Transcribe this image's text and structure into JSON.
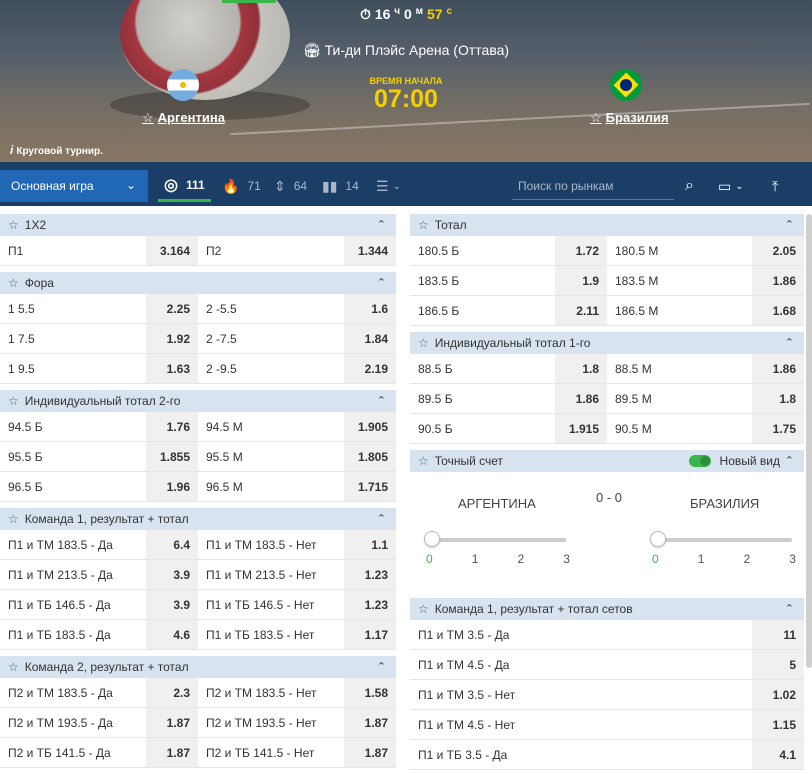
{
  "timer": {
    "hours": "16",
    "h_unit": "ч",
    "minutes": "0",
    "m_unit": "м",
    "seconds": "57",
    "s_unit": "с"
  },
  "venue": "Ти-ди Плэйс Арена (Оттава)",
  "start_label": "ВРЕМЯ НАЧАЛА",
  "start_time": "07:00",
  "team_a": "Аргентина",
  "team_b": "Бразилия",
  "tournament": "Круговой турнир.",
  "toolbar": {
    "dropdown": "Основная игра",
    "tab_all": "111",
    "tab_hot": "71",
    "tab_updown": "64",
    "tab_live": "14",
    "search_placeholder": "Поиск по рынкам"
  },
  "left": [
    {
      "title": "1X2",
      "rows": [
        [
          "П1",
          "3.164",
          "П2",
          "1.344"
        ]
      ]
    },
    {
      "title": "Фора",
      "rows": [
        [
          "1 5.5",
          "2.25",
          "2 -5.5",
          "1.6"
        ],
        [
          "1 7.5",
          "1.92",
          "2 -7.5",
          "1.84"
        ],
        [
          "1 9.5",
          "1.63",
          "2 -9.5",
          "2.19"
        ]
      ]
    },
    {
      "title": "Индивидуальный тотал 2-го",
      "rows": [
        [
          "94.5 Б",
          "1.76",
          "94.5 М",
          "1.905"
        ],
        [
          "95.5 Б",
          "1.855",
          "95.5 М",
          "1.805"
        ],
        [
          "96.5 Б",
          "1.96",
          "96.5 М",
          "1.715"
        ]
      ]
    },
    {
      "title": "Команда 1, результат + тотал",
      "rows": [
        [
          "П1 и ТМ 183.5 - Да",
          "6.4",
          "П1 и ТМ 183.5 - Нет",
          "1.1"
        ],
        [
          "П1 и ТМ 213.5 - Да",
          "3.9",
          "П1 и ТМ 213.5 - Нет",
          "1.23"
        ],
        [
          "П1 и ТБ 146.5 - Да",
          "3.9",
          "П1 и ТБ 146.5 - Нет",
          "1.23"
        ],
        [
          "П1 и ТБ 183.5 - Да",
          "4.6",
          "П1 и ТБ 183.5 - Нет",
          "1.17"
        ]
      ]
    },
    {
      "title": "Команда 2, результат + тотал",
      "rows": [
        [
          "П2 и ТМ 183.5 - Да",
          "2.3",
          "П2 и ТМ 183.5 - Нет",
          "1.58"
        ],
        [
          "П2 и ТМ 193.5 - Да",
          "1.87",
          "П2 и ТМ 193.5 - Нет",
          "1.87"
        ],
        [
          "П2 и ТБ 141.5 - Да",
          "1.87",
          "П2 и ТБ 141.5 - Нет",
          "1.87"
        ]
      ]
    }
  ],
  "right_total": {
    "title": "Тотал",
    "rows": [
      [
        "180.5 Б",
        "1.72",
        "180.5 М",
        "2.05"
      ],
      [
        "183.5 Б",
        "1.9",
        "183.5 М",
        "1.86"
      ],
      [
        "186.5 Б",
        "2.11",
        "186.5 М",
        "1.68"
      ]
    ]
  },
  "right_ind1": {
    "title": "Индивидуальный тотал 1-го",
    "rows": [
      [
        "88.5 Б",
        "1.8",
        "88.5 М",
        "1.86"
      ],
      [
        "89.5 Б",
        "1.86",
        "89.5 М",
        "1.8"
      ],
      [
        "90.5 Б",
        "1.915",
        "90.5 М",
        "1.75"
      ]
    ]
  },
  "exact": {
    "title": "Точный счет",
    "new_view": "Новый вид",
    "team_a": "АРГЕНТИНА",
    "team_b": "БРАЗИЛИЯ",
    "score": "0 - 0",
    "ticks": [
      "0",
      "1",
      "2",
      "3"
    ]
  },
  "right_sets": {
    "title": "Команда 1, результат + тотал сетов",
    "rows": [
      [
        "П1 и ТМ 3.5 - Да",
        "11"
      ],
      [
        "П1 и ТМ 4.5 - Да",
        "5"
      ],
      [
        "П1 и ТМ 3.5 - Нет",
        "1.02"
      ],
      [
        "П1 и ТМ 4.5 - Нет",
        "1.15"
      ],
      [
        "П1 и ТБ 3.5 - Да",
        "4.1"
      ]
    ]
  }
}
